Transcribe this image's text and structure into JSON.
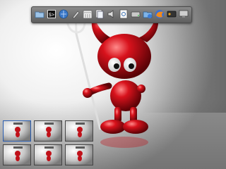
{
  "desktop": {
    "wallpaper": "freebsd-beastie-3d",
    "colors": {
      "mascot_red": "#c0121a",
      "dock_bg": "#6e6e6e"
    }
  },
  "dock": {
    "icons": [
      {
        "name": "folder-icon"
      },
      {
        "name": "terminal-icon",
        "text": "$>"
      },
      {
        "name": "network-icon"
      },
      {
        "name": "tools-icon"
      },
      {
        "name": "calendar-icon"
      },
      {
        "name": "documents-icon"
      },
      {
        "name": "volume-icon"
      },
      {
        "name": "viewer-icon"
      },
      {
        "name": "drive-icon"
      },
      {
        "name": "network-share-icon"
      },
      {
        "name": "browser-icon"
      },
      {
        "name": "media-icon"
      },
      {
        "name": "screen-icon"
      }
    ]
  },
  "pager": {
    "desktops": [
      {
        "name": "desktop-1",
        "active": true
      },
      {
        "name": "desktop-2",
        "active": false
      },
      {
        "name": "desktop-3",
        "active": false
      },
      {
        "name": "desktop-4",
        "active": false
      },
      {
        "name": "desktop-5",
        "active": false
      },
      {
        "name": "desktop-6",
        "active": false
      }
    ]
  }
}
